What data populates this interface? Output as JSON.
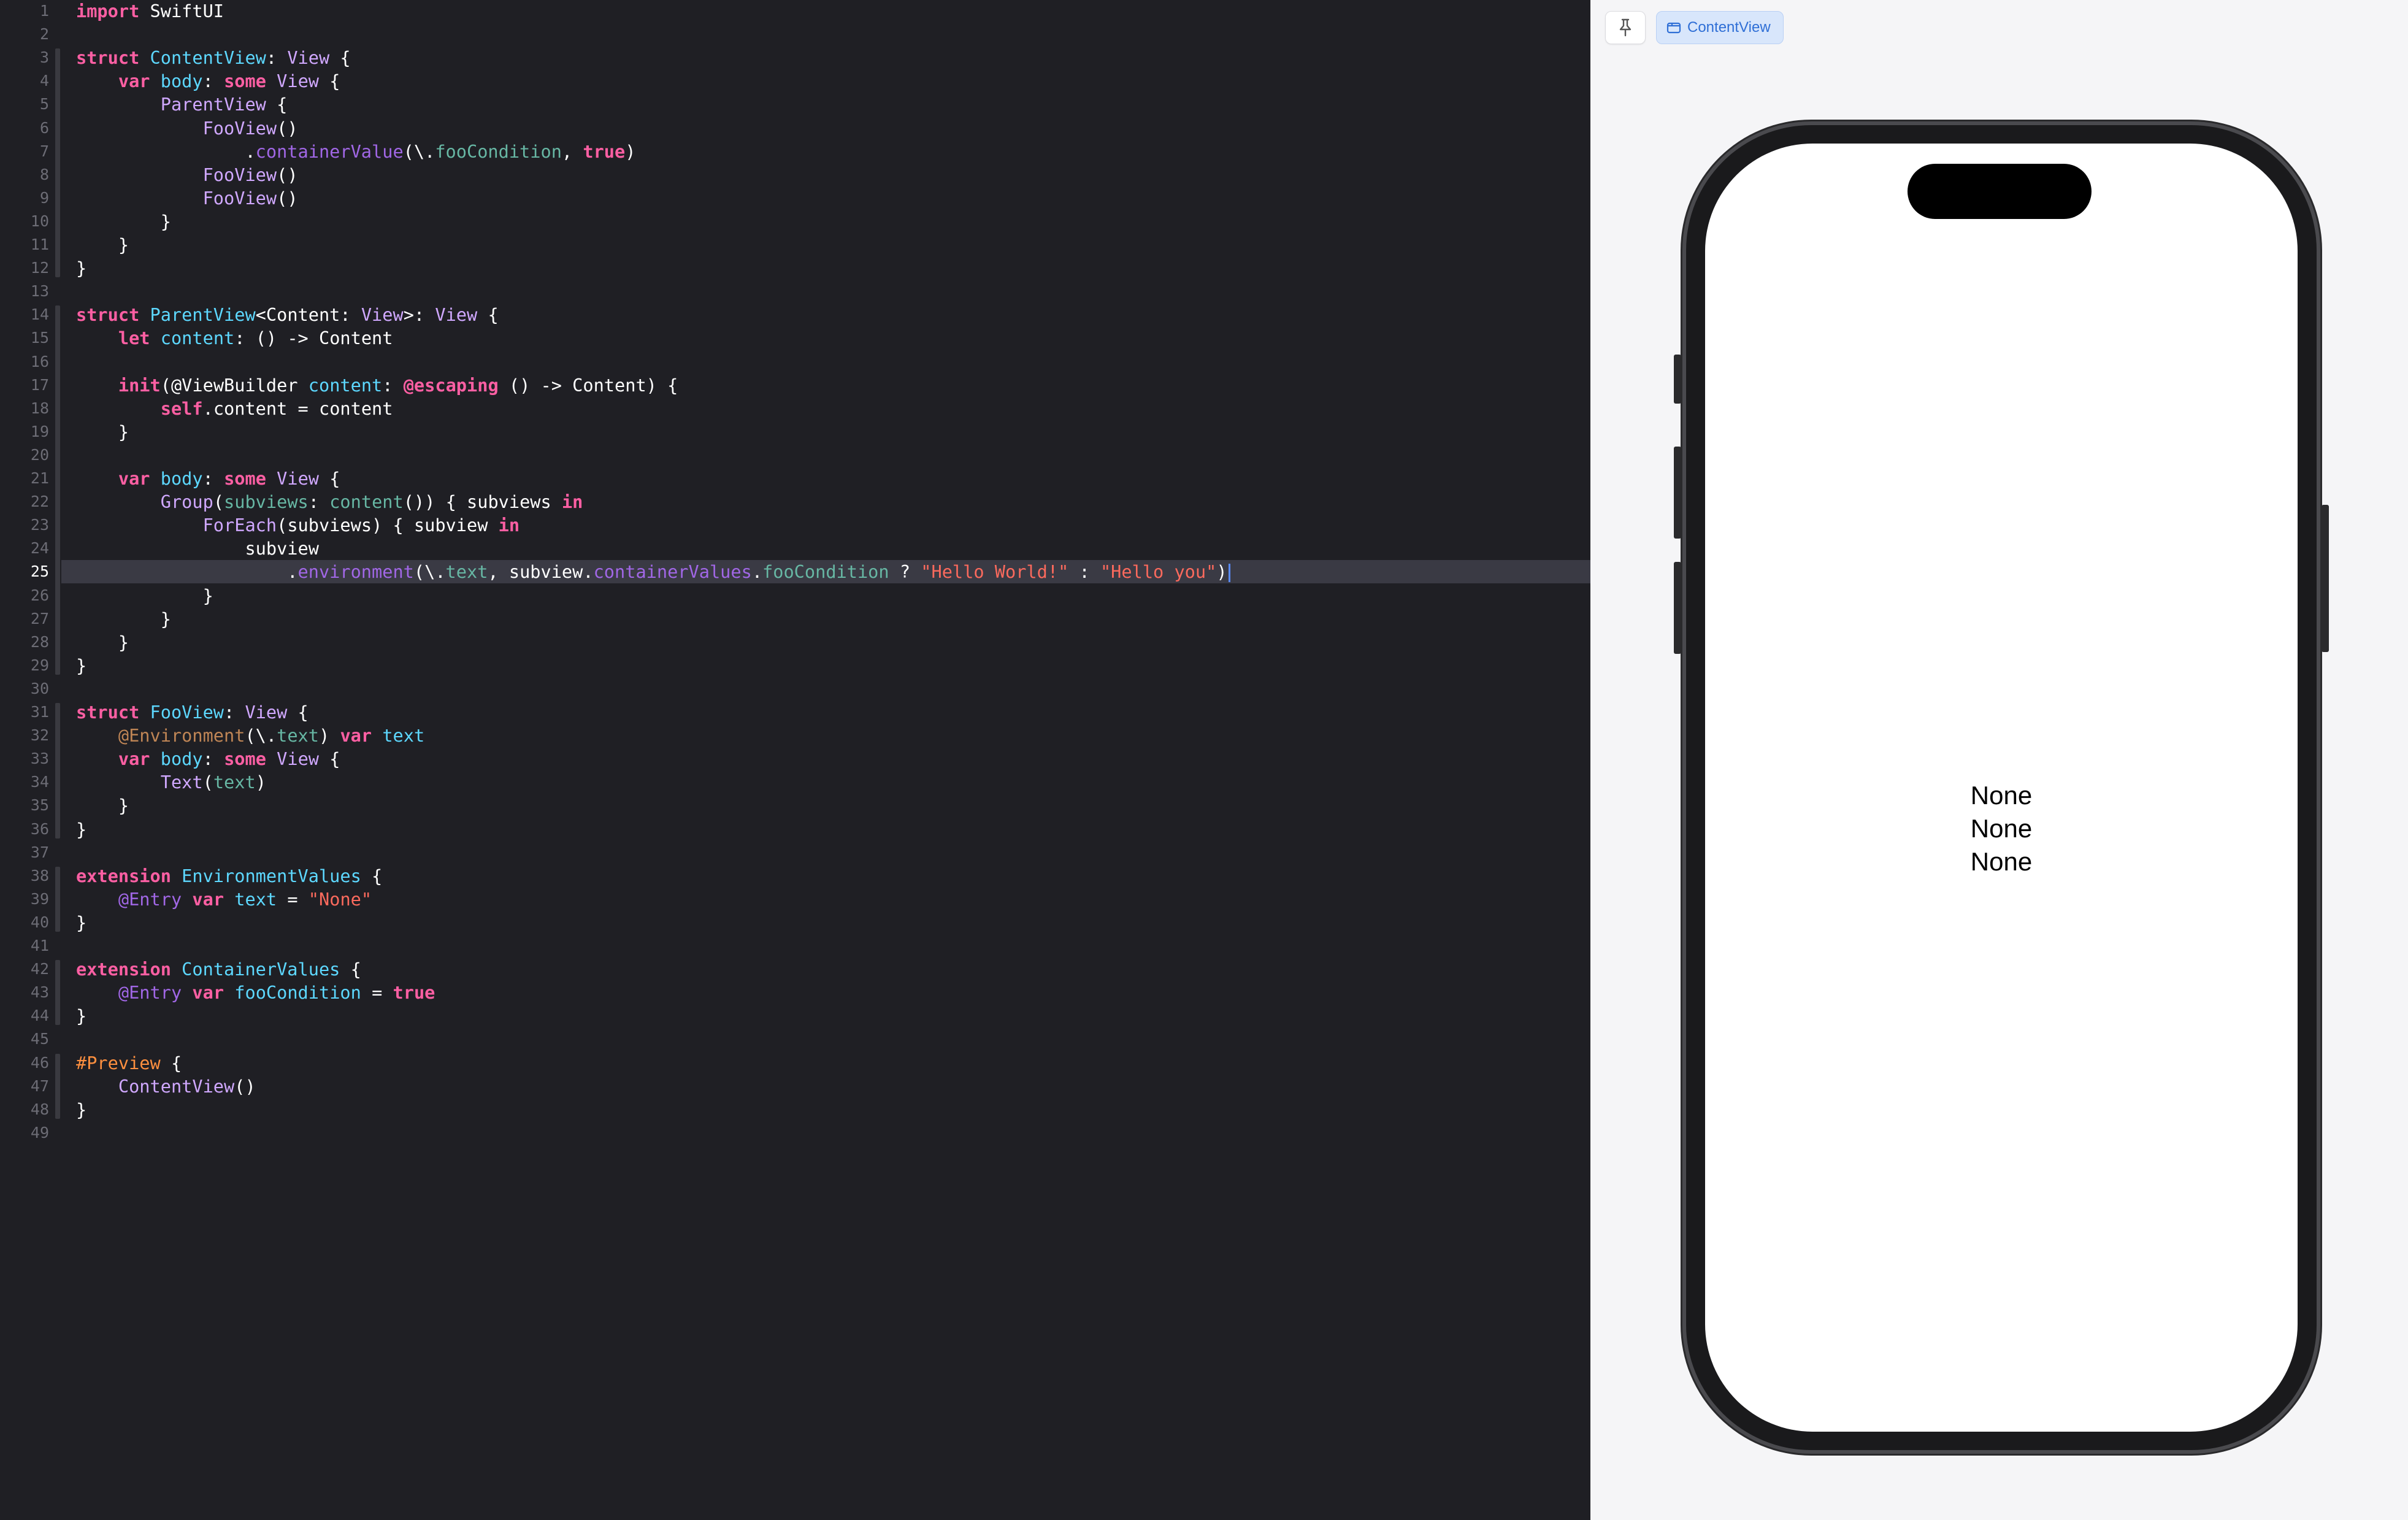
{
  "editor": {
    "current_line": 25,
    "code_lines": [
      [
        [
          "kw",
          "import"
        ],
        [
          "p",
          " SwiftUI"
        ]
      ],
      [],
      [
        [
          "kw",
          "struct"
        ],
        [
          "p",
          " "
        ],
        [
          "typ",
          "ContentView"
        ],
        [
          "p",
          ": "
        ],
        [
          "ty2",
          "View"
        ],
        [
          "p",
          " {"
        ]
      ],
      [
        [
          "p",
          "    "
        ],
        [
          "kw",
          "var"
        ],
        [
          "p",
          " "
        ],
        [
          "typ",
          "body"
        ],
        [
          "p",
          ": "
        ],
        [
          "kw",
          "some"
        ],
        [
          "p",
          " "
        ],
        [
          "ty2",
          "View"
        ],
        [
          "p",
          " {"
        ]
      ],
      [
        [
          "p",
          "        "
        ],
        [
          "ty2",
          "ParentView"
        ],
        [
          "p",
          " {"
        ]
      ],
      [
        [
          "p",
          "            "
        ],
        [
          "ty2",
          "FooView"
        ],
        [
          "p",
          "()"
        ]
      ],
      [
        [
          "p",
          "                ."
        ],
        [
          "fn",
          "containerValue"
        ],
        [
          "p",
          "(\\."
        ],
        [
          "prop",
          "fooCondition"
        ],
        [
          "p",
          ", "
        ],
        [
          "kw",
          "true"
        ],
        [
          "p",
          ")"
        ]
      ],
      [
        [
          "p",
          "            "
        ],
        [
          "ty2",
          "FooView"
        ],
        [
          "p",
          "()"
        ]
      ],
      [
        [
          "p",
          "            "
        ],
        [
          "ty2",
          "FooView"
        ],
        [
          "p",
          "()"
        ]
      ],
      [
        [
          "p",
          "        }"
        ]
      ],
      [
        [
          "p",
          "    }"
        ]
      ],
      [
        [
          "p",
          "}"
        ]
      ],
      [],
      [
        [
          "kw",
          "struct"
        ],
        [
          "p",
          " "
        ],
        [
          "typ",
          "ParentView"
        ],
        [
          "p",
          "<Content: "
        ],
        [
          "ty2",
          "View"
        ],
        [
          "p",
          ">: "
        ],
        [
          "ty2",
          "View"
        ],
        [
          "p",
          " {"
        ]
      ],
      [
        [
          "p",
          "    "
        ],
        [
          "kw",
          "let"
        ],
        [
          "p",
          " "
        ],
        [
          "typ",
          "content"
        ],
        [
          "p",
          ": () -> Content"
        ]
      ],
      [],
      [
        [
          "p",
          "    "
        ],
        [
          "kw",
          "init"
        ],
        [
          "p",
          "(@ViewBuilder "
        ],
        [
          "typ",
          "content"
        ],
        [
          "p",
          ": "
        ],
        [
          "kw",
          "@escaping"
        ],
        [
          "p",
          " () -> Content) {"
        ]
      ],
      [
        [
          "p",
          "        "
        ],
        [
          "kw",
          "self"
        ],
        [
          "p",
          ".content = content"
        ]
      ],
      [
        [
          "p",
          "    }"
        ]
      ],
      [],
      [
        [
          "p",
          "    "
        ],
        [
          "kw",
          "var"
        ],
        [
          "p",
          " "
        ],
        [
          "typ",
          "body"
        ],
        [
          "p",
          ": "
        ],
        [
          "kw",
          "some"
        ],
        [
          "p",
          " "
        ],
        [
          "ty2",
          "View"
        ],
        [
          "p",
          " {"
        ]
      ],
      [
        [
          "p",
          "        "
        ],
        [
          "ty2",
          "Group"
        ],
        [
          "p",
          "("
        ],
        [
          "prop",
          "subviews"
        ],
        [
          "p",
          ": "
        ],
        [
          "prop",
          "content"
        ],
        [
          "p",
          "()) { subviews "
        ],
        [
          "kw",
          "in"
        ]
      ],
      [
        [
          "p",
          "            "
        ],
        [
          "ty2",
          "ForEach"
        ],
        [
          "p",
          "(subviews) { subview "
        ],
        [
          "kw",
          "in"
        ]
      ],
      [
        [
          "p",
          "                subview"
        ]
      ],
      [
        [
          "p",
          "                    ."
        ],
        [
          "fn",
          "environment"
        ],
        [
          "p",
          "(\\."
        ],
        [
          "prop",
          "text"
        ],
        [
          "p",
          ", subview."
        ],
        [
          "fn",
          "containerValues"
        ],
        [
          "p",
          "."
        ],
        [
          "prop",
          "fooCondition"
        ],
        [
          "p",
          " ? "
        ],
        [
          "str",
          "\"Hello World!\""
        ],
        [
          "p",
          " : "
        ],
        [
          "str",
          "\"Hello you\""
        ],
        [
          "p",
          ")"
        ]
      ],
      [
        [
          "p",
          "            }"
        ]
      ],
      [
        [
          "p",
          "        }"
        ]
      ],
      [
        [
          "p",
          "    }"
        ]
      ],
      [
        [
          "p",
          "}"
        ]
      ],
      [],
      [
        [
          "kw",
          "struct"
        ],
        [
          "p",
          " "
        ],
        [
          "typ",
          "FooView"
        ],
        [
          "p",
          ": "
        ],
        [
          "ty2",
          "View"
        ],
        [
          "p",
          " {"
        ]
      ],
      [
        [
          "p",
          "    "
        ],
        [
          "attr",
          "@Environment"
        ],
        [
          "p",
          "(\\."
        ],
        [
          "prop",
          "text"
        ],
        [
          "p",
          ") "
        ],
        [
          "kw",
          "var"
        ],
        [
          "p",
          " "
        ],
        [
          "typ",
          "text"
        ]
      ],
      [
        [
          "p",
          "    "
        ],
        [
          "kw",
          "var"
        ],
        [
          "p",
          " "
        ],
        [
          "typ",
          "body"
        ],
        [
          "p",
          ": "
        ],
        [
          "kw",
          "some"
        ],
        [
          "p",
          " "
        ],
        [
          "ty2",
          "View"
        ],
        [
          "p",
          " {"
        ]
      ],
      [
        [
          "p",
          "        "
        ],
        [
          "ty2",
          "Text"
        ],
        [
          "p",
          "("
        ],
        [
          "prop",
          "text"
        ],
        [
          "p",
          ")"
        ]
      ],
      [
        [
          "p",
          "    }"
        ]
      ],
      [
        [
          "p",
          "}"
        ]
      ],
      [],
      [
        [
          "kw",
          "extension"
        ],
        [
          "p",
          " "
        ],
        [
          "typ",
          "EnvironmentValues"
        ],
        [
          "p",
          " {"
        ]
      ],
      [
        [
          "p",
          "    "
        ],
        [
          "fn",
          "@Entry"
        ],
        [
          "p",
          " "
        ],
        [
          "kw",
          "var"
        ],
        [
          "p",
          " "
        ],
        [
          "typ",
          "text"
        ],
        [
          "p",
          " = "
        ],
        [
          "str",
          "\"None\""
        ]
      ],
      [
        [
          "p",
          "}"
        ]
      ],
      [],
      [
        [
          "kw",
          "extension"
        ],
        [
          "p",
          " "
        ],
        [
          "typ",
          "ContainerValues"
        ],
        [
          "p",
          " {"
        ]
      ],
      [
        [
          "p",
          "    "
        ],
        [
          "fn",
          "@Entry"
        ],
        [
          "p",
          " "
        ],
        [
          "kw",
          "var"
        ],
        [
          "p",
          " "
        ],
        [
          "typ",
          "fooCondition"
        ],
        [
          "p",
          " = "
        ],
        [
          "kw",
          "true"
        ]
      ],
      [
        [
          "p",
          "}"
        ]
      ],
      [],
      [
        [
          "pp",
          "#Preview"
        ],
        [
          "p",
          " {"
        ]
      ],
      [
        [
          "p",
          "    "
        ],
        [
          "ty2",
          "ContentView"
        ],
        [
          "p",
          "()"
        ]
      ],
      [
        [
          "p",
          "}"
        ]
      ],
      []
    ]
  },
  "preview": {
    "tab_label": "ContentView",
    "pin_icon": "pin-icon",
    "tab_icon": "window-icon",
    "simulator_text": [
      "None",
      "None",
      "None"
    ]
  },
  "colors": {
    "editor_bg": "#1f1f24",
    "keyword": "#fc5fa3",
    "type_decl": "#5dd8ff",
    "type_ref": "#d0a8ff",
    "function": "#a167e6",
    "property": "#67b7a4",
    "string": "#fc6a5d",
    "accent": "#2f6fd6"
  }
}
